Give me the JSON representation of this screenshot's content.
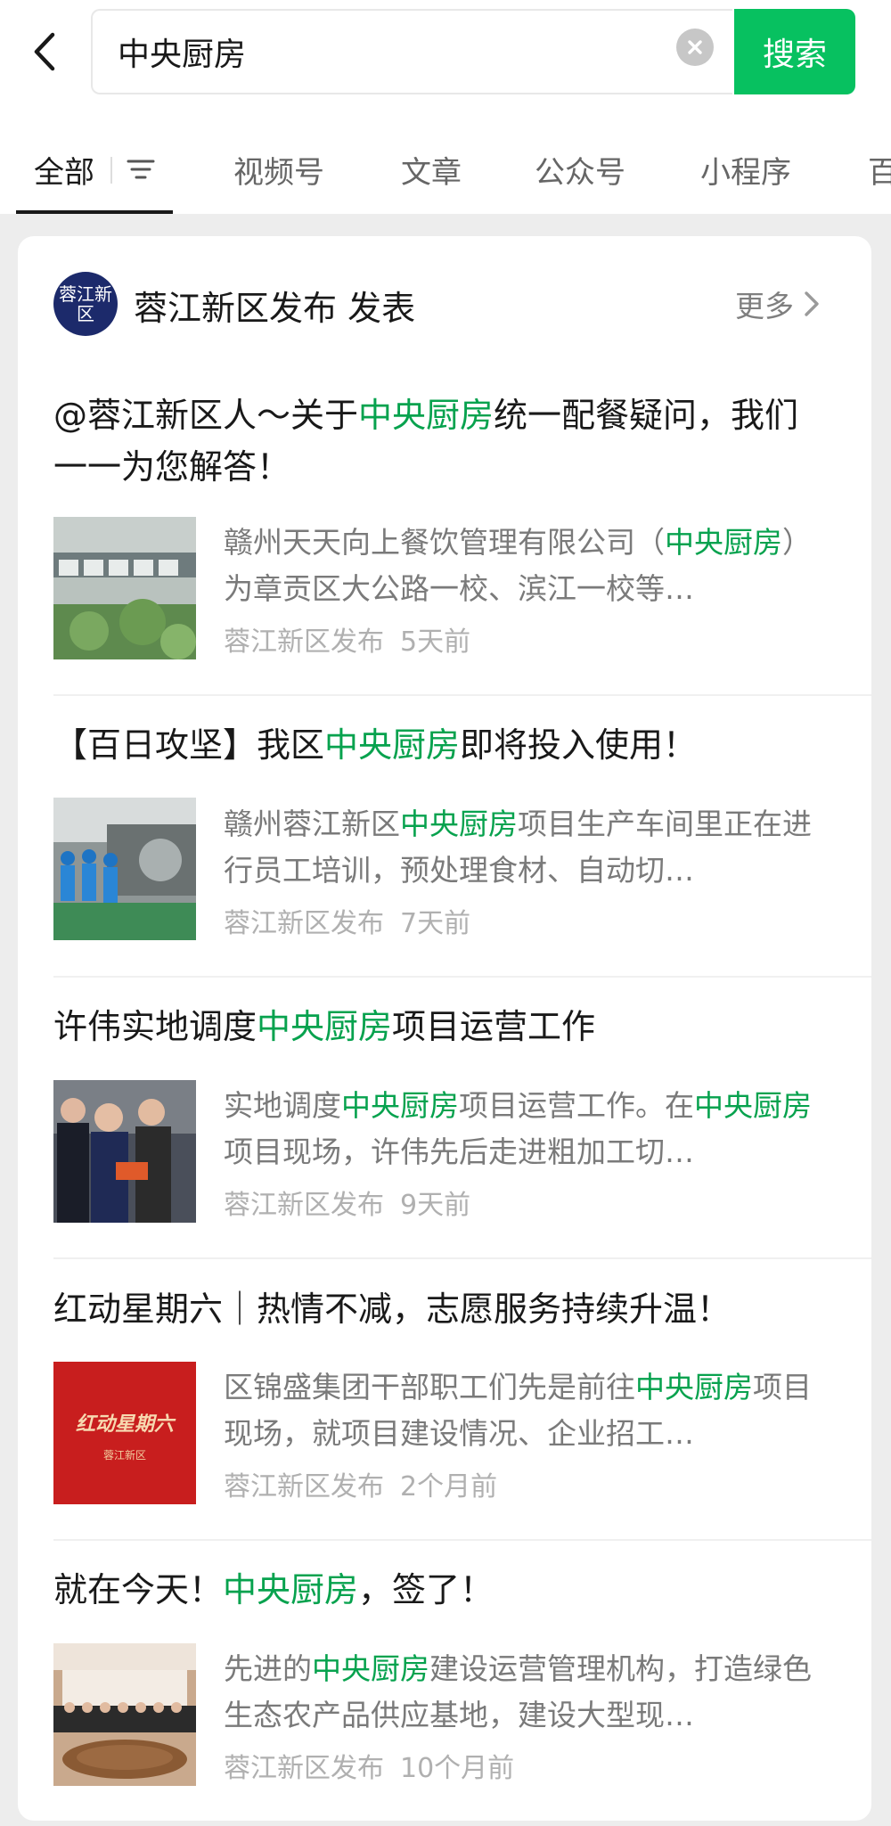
{
  "search": {
    "query": "中央厨房",
    "button_label": "搜索"
  },
  "tabs": [
    {
      "label": "全部"
    },
    {
      "label": "视频号"
    },
    {
      "label": "文章"
    },
    {
      "label": "公众号"
    },
    {
      "label": "小程序"
    },
    {
      "label": "百"
    }
  ],
  "account": {
    "avatar_text": "蓉江新区",
    "title": "蓉江新区发布 发表",
    "more_label": "更多"
  },
  "articles": [
    {
      "title_parts": [
        "@蓉江新区人～关于",
        "中央厨房",
        "统一配餐疑问，我们一一为您解答！"
      ],
      "snippet_parts": [
        "赣州天天向上餐饮管理有限公司（",
        "中央厨房",
        "）为章贡区大公路一校、滨江一校等…"
      ],
      "source": "蓉江新区发布",
      "time": "5天前"
    },
    {
      "title_parts": [
        "【百日攻坚】我区",
        "中央厨房",
        "即将投入使用！"
      ],
      "snippet_parts": [
        "赣州蓉江新区",
        "中央厨房",
        "项目生产车间里正在进行员工培训，预处理食材、自动切…"
      ],
      "source": "蓉江新区发布",
      "time": "7天前"
    },
    {
      "title_parts": [
        "许伟实地调度",
        "中央厨房",
        "项目运营工作"
      ],
      "snippet_parts": [
        "实地调度",
        "中央厨房",
        "项目运营工作。在",
        "中央厨房",
        "项目现场，许伟先后走进粗加工切…"
      ],
      "source": "蓉江新区发布",
      "time": "9天前"
    },
    {
      "title_parts": [
        "红动星期六｜热情不减，志愿服务持续升温！"
      ],
      "snippet_parts": [
        "区锦盛集团干部职工们先是前往",
        "中央厨房",
        "项目现场，就项目建设情况、企业招工…"
      ],
      "source": "蓉江新区发布",
      "time": "2个月前",
      "thumb_text": "红动星期六",
      "thumb_subtext": "蓉江新区"
    },
    {
      "title_parts": [
        "就在今天！",
        "中央厨房",
        "，签了！"
      ],
      "snippet_parts": [
        "先进的",
        "中央厨房",
        "建设运营管理机构，打造绿色生态农产品供应基地，建设大型现…"
      ],
      "source": "蓉江新区发布",
      "time": "10个月前"
    }
  ],
  "colors": {
    "accent": "#07c160",
    "highlight": "#07a24e",
    "avatar_bg": "#1c2a6b"
  }
}
